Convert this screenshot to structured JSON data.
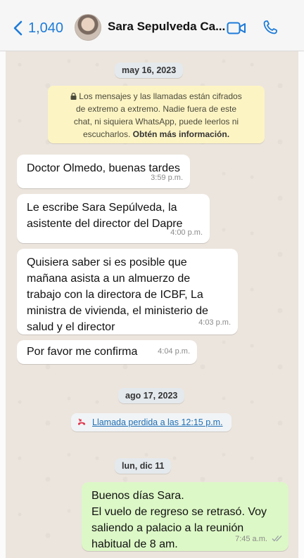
{
  "header": {
    "back_count": "1,040",
    "contact_name": "Sara Sepulveda Ca...",
    "accent_color": "#1d7bd9"
  },
  "dates": {
    "d1": "may 16, 2023",
    "d2": "ago 17, 2023",
    "d3": "lun, dic 11"
  },
  "security": {
    "line1": "Los mensajes y las llamadas están cifrados",
    "line2": "de extremo a extremo. Nadie fuera de este",
    "line3": "chat, ni siquiera WhatsApp, puede leerlos ni",
    "line4_plain": "escucharlos.",
    "line4_bold": "Obtén más información."
  },
  "messages": [
    {
      "text": "Doctor Olmedo, buenas tardes",
      "time": "3:59 p.m."
    },
    {
      "lines": [
        "Le escribe Sara Sepúlveda, la",
        "asistente del director del Dapre"
      ],
      "time": "4:00 p.m."
    },
    {
      "lines": [
        "Quisiera saber si es posible que",
        "mañana asista a un almuerzo de",
        "trabajo con la directora de ICBF, La",
        "ministra de vivienda, el ministerio de",
        "salud y el director"
      ],
      "time": "4:03 p.m."
    },
    {
      "text": "Por favor me confirma",
      "time": "4:04 p.m."
    },
    {
      "lines": [
        "Buenos días Sara.",
        "El vuelo de regreso se retrasó. Voy",
        "saliendo a palacio a la reunión",
        "habitual de 8 am."
      ],
      "time": "7:45 a.m."
    }
  ],
  "missed_call": "Llamada perdida a las 12:15 p.m.",
  "icons": [
    "back-chevron-icon",
    "video-call-icon",
    "phone-icon",
    "lock-icon",
    "missed-call-icon",
    "read-ticks-icon"
  ]
}
